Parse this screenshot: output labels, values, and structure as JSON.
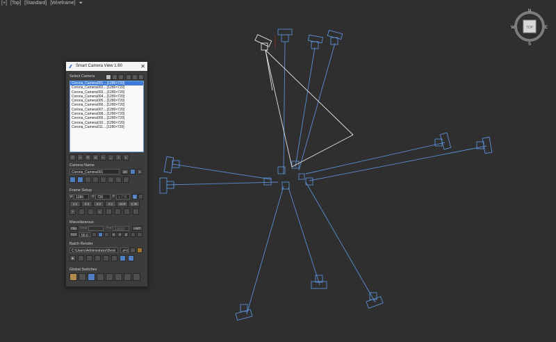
{
  "viewport": {
    "label_parts": [
      "[+]",
      "[Top]",
      "[Standard]",
      "[Wireframe]"
    ],
    "filter_icon": "funnel-icon"
  },
  "viewcube": {
    "n": "N",
    "s": "S",
    "e": "E",
    "w": "W",
    "face": "TOP"
  },
  "dialog": {
    "title": "Smart Camera View 1.60",
    "close": "✕",
    "select_camera_label": "Select Camera",
    "cameras": [
      "Corona_Camera001....[1280×720]",
      "Corona_Camera002....[1280×720]",
      "Corona_Camera003....[1280×720]",
      "Corona_Camera004....[1280×720]",
      "Corona_Camera005....[1280×720]",
      "Corona_Camera006....[1280×720]",
      "Corona_Camera007....[1280×720]",
      "Corona_Camera008....[1280×720]",
      "Corona_Camera009....[1280×720]",
      "Corona_Camera010....[1280×720]",
      "Corona_Camera011....[1280×720]"
    ],
    "camera_name_label": "Camera Name",
    "camera_name_value": "Corona_Camera001",
    "ok_label": "OK",
    "frame_setup_label": "Frame Setup",
    "w_label": "W",
    "w_value": "1280",
    "h_label": "H",
    "h_value": "720",
    "p_label": "P",
    "p_value": "1.778",
    "l_label": "L",
    "ratios": [
      "1:1",
      "4:3",
      "3:2",
      "2:1",
      "16:9",
      "2.35"
    ],
    "misc_label": "Miscellaneous",
    "clip_label": "Clip",
    "near_label": "Near",
    "far_label": "Far",
    "far_value": "10000",
    "amt_label": "AMT",
    "tgt_label": "TGT",
    "tgt_value": "50.0",
    "axis_labels": [
      "X",
      "Y",
      "Z"
    ],
    "batch_label": "Batch Render",
    "path_value": "C:\\Users\\Administrator\\Desk",
    "ext_value": "JPG",
    "dots_label": "...",
    "global_label": "Global Switches"
  },
  "colors": {
    "camera_wire": "#5b8fd6",
    "selected_wire": "#e6e6e6",
    "accent": "#3d7bd6"
  }
}
